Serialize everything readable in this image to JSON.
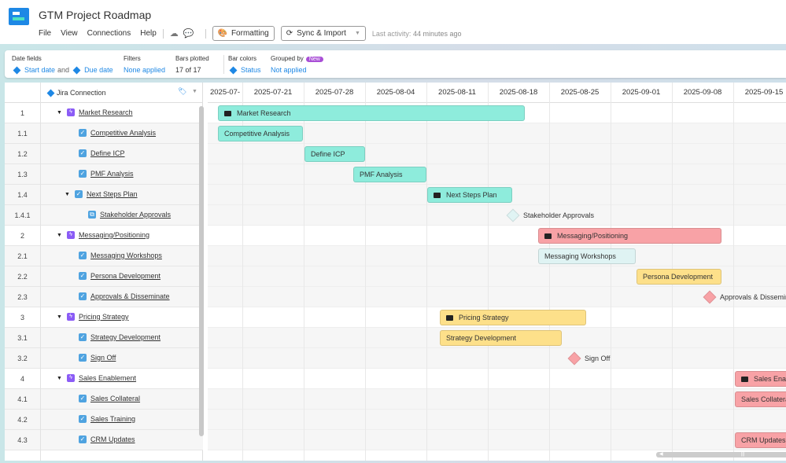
{
  "app": {
    "title": "GTM Project Roadmap",
    "menu": [
      "File",
      "View",
      "Connections",
      "Help"
    ],
    "formatting": "Formatting",
    "sync": "Sync & Import",
    "last_activity_label": "Last activity:",
    "last_activity_value": "44 minutes ago"
  },
  "filters": {
    "date_fields_label": "Date fields",
    "start": "Start date",
    "and": "and",
    "due": "Due date",
    "filters_label": "Filters",
    "filters_value": "None applied",
    "bars_label": "Bars plotted",
    "bars_value": "17 of 17",
    "colors_label": "Bar colors",
    "colors_value": "Status",
    "grouped_label": "Grouped by",
    "grouped_badge": "New",
    "grouped_value": "Not applied"
  },
  "grid": {
    "column": "Jira Connection",
    "weeks": [
      "2025-07-",
      "2025-07-21",
      "2025-07-28",
      "2025-08-04",
      "2025-08-11",
      "2025-08-18",
      "2025-08-25",
      "2025-09-01",
      "2025-09-08",
      "2025-09-15"
    ]
  },
  "rows": [
    {
      "num": "1",
      "name": "Market Research"
    },
    {
      "num": "1.1",
      "name": "Competitive Analysis"
    },
    {
      "num": "1.2",
      "name": "Define ICP"
    },
    {
      "num": "1.3",
      "name": "PMF Analysis"
    },
    {
      "num": "1.4",
      "name": "Next Steps Plan"
    },
    {
      "num": "1.4.1",
      "name": "Stakeholder Approvals"
    },
    {
      "num": "2",
      "name": "Messaging/Positioning"
    },
    {
      "num": "2.1",
      "name": "Messaging Workshops"
    },
    {
      "num": "2.2",
      "name": "Persona Development"
    },
    {
      "num": "2.3",
      "name": "Approvals & Disseminate"
    },
    {
      "num": "3",
      "name": "Pricing Strategy"
    },
    {
      "num": "3.1",
      "name": "Strategy Development"
    },
    {
      "num": "3.2",
      "name": "Sign Off"
    },
    {
      "num": "4",
      "name": "Sales Enablement"
    },
    {
      "num": "4.1",
      "name": "Sales Collateral"
    },
    {
      "num": "4.2",
      "name": "Sales Training"
    },
    {
      "num": "4.3",
      "name": "CRM Updates"
    }
  ],
  "colors": {
    "teal": "#8eecdc",
    "red": "#f8a2a6",
    "yellow": "#fde08a",
    "light": "#dff3f3",
    "accent": "#1e88e5"
  }
}
